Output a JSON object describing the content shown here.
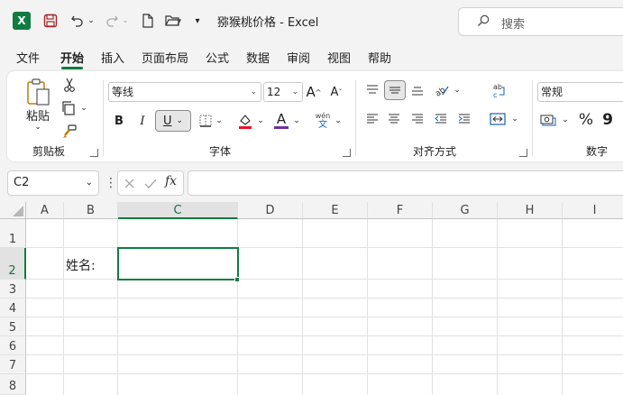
{
  "window": {
    "title": "猕猴桃价格  -  Excel"
  },
  "search": {
    "placeholder": "搜索"
  },
  "menu": {
    "tabs": [
      {
        "label": "文件"
      },
      {
        "label": "开始"
      },
      {
        "label": "插入"
      },
      {
        "label": "页面布局"
      },
      {
        "label": "公式"
      },
      {
        "label": "数据"
      },
      {
        "label": "审阅"
      },
      {
        "label": "视图"
      },
      {
        "label": "帮助"
      }
    ],
    "active": "开始"
  },
  "ribbon": {
    "clipboard": {
      "label": "剪贴板",
      "paste_label": "粘贴"
    },
    "font": {
      "label": "字体",
      "font_name": "等线",
      "font_size": "12",
      "bold": "B",
      "italic": "I",
      "underline": "U",
      "grow": "A",
      "shrink": "A",
      "phonetic_top": "wén",
      "phonetic_bottom": "文",
      "font_color_letter": "A"
    },
    "alignment": {
      "label": "对齐方式"
    },
    "number": {
      "label": "数字",
      "format": "常规",
      "percent": "%",
      "comma": "9"
    }
  },
  "formula_bar": {
    "name_box": "C2",
    "fx": "fx",
    "formula": ""
  },
  "grid": {
    "columns": [
      "A",
      "B",
      "C",
      "D",
      "E",
      "F",
      "G",
      "H",
      "I"
    ],
    "rows": [
      "1",
      "2",
      "3",
      "4",
      "5",
      "6",
      "7",
      "8"
    ],
    "selected_column": "C",
    "selected_row": "2",
    "cells": {
      "B2": "姓名:"
    }
  },
  "colors": {
    "accent": "#107c41",
    "font_color": "#e81123",
    "fill_color": "#7030a0"
  }
}
